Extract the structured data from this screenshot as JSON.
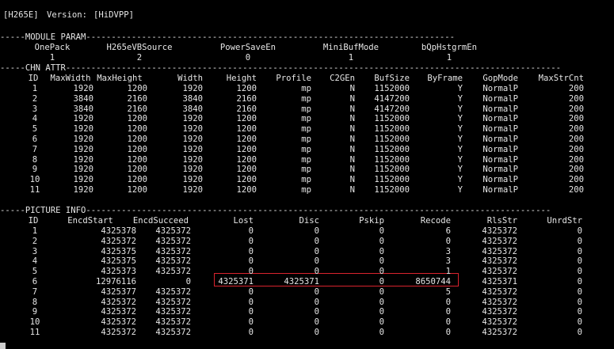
{
  "header": {
    "tag": "[H265E]",
    "version_label": "Version:",
    "version": "[HiDVPP]"
  },
  "module_param": {
    "section": "-----MODULE PARAM-------------------------------------------------------------------------",
    "cols": [
      "OnePack",
      "H265eVBSource",
      "PowerSaveEn",
      "MiniBufMode",
      "bQpHstgrmEn"
    ],
    "values": [
      "1",
      "2",
      "0",
      "1",
      "1"
    ]
  },
  "chn_attr": {
    "section": "-----CHN ATTR--------------------------------------------------------------------------------------------------",
    "cols": [
      "ID",
      "MaxWidth",
      "MaxHeight",
      "Width",
      "Height",
      "Profile",
      "C2GEn",
      "BufSize",
      "ByFrame",
      "GopMode",
      "MaxStrCnt"
    ],
    "rows": [
      [
        "1",
        "1920",
        "1200",
        "1920",
        "1200",
        "mp",
        "N",
        "1152000",
        "Y",
        "NormalP",
        "200"
      ],
      [
        "2",
        "3840",
        "2160",
        "3840",
        "2160",
        "mp",
        "N",
        "4147200",
        "Y",
        "NormalP",
        "200"
      ],
      [
        "3",
        "3840",
        "2160",
        "3840",
        "2160",
        "mp",
        "N",
        "4147200",
        "Y",
        "NormalP",
        "200"
      ],
      [
        "4",
        "1920",
        "1200",
        "1920",
        "1200",
        "mp",
        "N",
        "1152000",
        "Y",
        "NormalP",
        "200"
      ],
      [
        "5",
        "1920",
        "1200",
        "1920",
        "1200",
        "mp",
        "N",
        "1152000",
        "Y",
        "NormalP",
        "200"
      ],
      [
        "6",
        "1920",
        "1200",
        "1920",
        "1200",
        "mp",
        "N",
        "1152000",
        "Y",
        "NormalP",
        "200"
      ],
      [
        "7",
        "1920",
        "1200",
        "1920",
        "1200",
        "mp",
        "N",
        "1152000",
        "Y",
        "NormalP",
        "200"
      ],
      [
        "8",
        "1920",
        "1200",
        "1920",
        "1200",
        "mp",
        "N",
        "1152000",
        "Y",
        "NormalP",
        "200"
      ],
      [
        "9",
        "1920",
        "1200",
        "1920",
        "1200",
        "mp",
        "N",
        "1152000",
        "Y",
        "NormalP",
        "200"
      ],
      [
        "10",
        "1920",
        "1200",
        "1920",
        "1200",
        "mp",
        "N",
        "1152000",
        "Y",
        "NormalP",
        "200"
      ],
      [
        "11",
        "1920",
        "1200",
        "1920",
        "1200",
        "mp",
        "N",
        "1152000",
        "Y",
        "NormalP",
        "200"
      ]
    ]
  },
  "picture_info": {
    "section": "-----PICTURE INFO--------------------------------------------------------------------------------------------",
    "cols": [
      "ID",
      "EncdStart",
      "EncdSucceed",
      "Lost",
      "Disc",
      "Pskip",
      "Recode",
      "RlsStr",
      "UnrdStr"
    ],
    "rows": [
      [
        "1",
        "4325378",
        "4325372",
        "0",
        "0",
        "0",
        "6",
        "4325372",
        "0"
      ],
      [
        "2",
        "4325372",
        "4325372",
        "0",
        "0",
        "0",
        "0",
        "4325372",
        "0"
      ],
      [
        "3",
        "4325375",
        "4325372",
        "0",
        "0",
        "0",
        "3",
        "4325372",
        "0"
      ],
      [
        "4",
        "4325375",
        "4325372",
        "0",
        "0",
        "0",
        "3",
        "4325372",
        "0"
      ],
      [
        "5",
        "4325373",
        "4325372",
        "0",
        "0",
        "0",
        "1",
        "4325372",
        "0"
      ],
      [
        "6",
        "12976116",
        "0",
        "4325371",
        "4325371",
        "0",
        "8650744",
        "4325371",
        "0"
      ],
      [
        "7",
        "4325377",
        "4325372",
        "0",
        "0",
        "0",
        "5",
        "4325372",
        "0"
      ],
      [
        "8",
        "4325372",
        "4325372",
        "0",
        "0",
        "0",
        "0",
        "4325372",
        "0"
      ],
      [
        "9",
        "4325372",
        "4325372",
        "0",
        "0",
        "0",
        "0",
        "4325372",
        "0"
      ],
      [
        "10",
        "4325372",
        "4325372",
        "0",
        "0",
        "0",
        "0",
        "4325372",
        "0"
      ],
      [
        "11",
        "4325372",
        "4325372",
        "0",
        "0",
        "0",
        "0",
        "4325372",
        "0"
      ]
    ]
  },
  "colors": {
    "background": "#000000",
    "text": "#e6e6e6",
    "highlight_border": "#d9232e"
  }
}
